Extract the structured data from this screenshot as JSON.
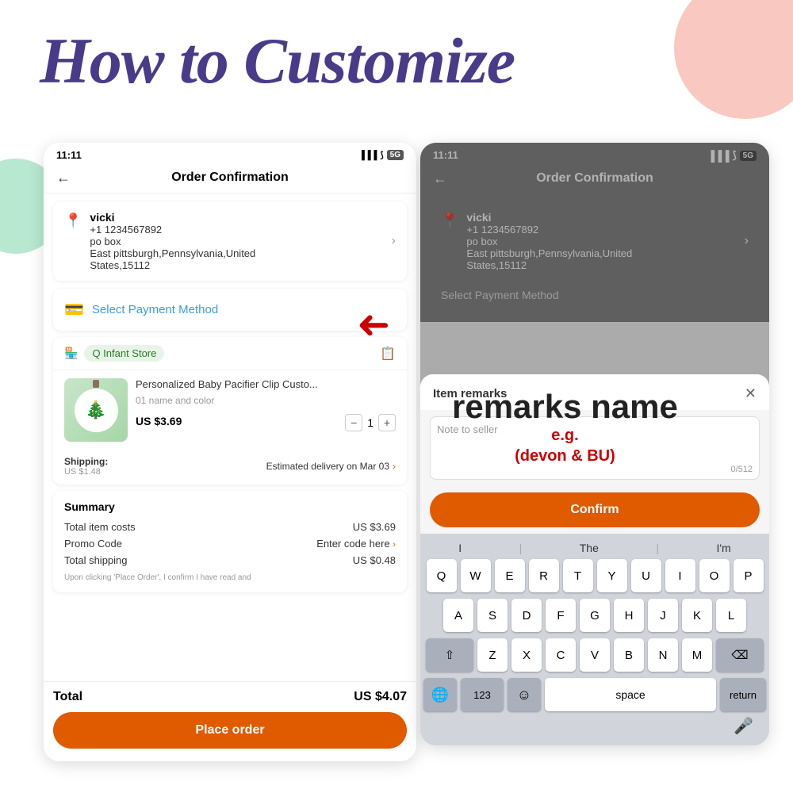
{
  "page": {
    "title": "How to Customize",
    "bg_circle_colors": [
      "#f9c8c0",
      "#b8e8d0"
    ]
  },
  "left_phone": {
    "status_time": "11:11",
    "status_signal": "▐▐▐",
    "status_wifi": "WiFi",
    "status_5g": "5G",
    "header_title": "Order Confirmation",
    "back_arrow": "←",
    "address": {
      "name": "vicki",
      "phone": "+1 1234567892",
      "po": "po box",
      "city": "East pittsburgh,Pennsylvania,United",
      "city2": "States,15112"
    },
    "payment": {
      "label": "Select Payment Method"
    },
    "store": {
      "icon": "🏪",
      "name": "Q Infant Store"
    },
    "product": {
      "title": "Personalized Baby Pacifier Clip Custo...",
      "variant": "01 name and color",
      "price": "US $3.69",
      "qty": "1"
    },
    "shipping": {
      "label": "Shipping:",
      "cost": "US $1.48",
      "estimate": "Estimated delivery on Mar 03"
    },
    "summary": {
      "title": "Summary",
      "item_costs_label": "Total item costs",
      "item_costs_value": "US $3.69",
      "promo_label": "Promo Code",
      "promo_value": "Enter code here",
      "shipping_label": "Total shipping",
      "shipping_value": "US $0.48",
      "disclaimer": "Upon clicking 'Place Order', I confirm I have read and",
      "total_label": "Total",
      "total_value": "US $4.07"
    },
    "place_order_btn": "Place order"
  },
  "right_phone": {
    "status_time": "11:11",
    "header_title": "Order Confirmation",
    "back_arrow": "←",
    "address": {
      "name": "vicki",
      "phone": "+1 1234567892",
      "po": "po box",
      "city": "East pittsburgh,Pennsylvania,United",
      "city2": "States,15112"
    },
    "payment_label": "Select Payment Method"
  },
  "modal": {
    "title": "Item remarks",
    "close": "✕",
    "placeholder": "Note to seller",
    "char_count": "0/512",
    "confirm_btn": "Confirm"
  },
  "keyboard": {
    "suggestions": [
      "I",
      "|",
      "The",
      "|",
      "I'm"
    ],
    "row1": [
      "Q",
      "W",
      "E",
      "R",
      "T",
      "Y",
      "U",
      "I",
      "O",
      "P"
    ],
    "row2": [
      "A",
      "S",
      "D",
      "F",
      "G",
      "H",
      "J",
      "K",
      "L"
    ],
    "row3": [
      "⇧",
      "Z",
      "X",
      "C",
      "V",
      "B",
      "N",
      "M",
      "⌫"
    ],
    "row4_left": "123",
    "row4_emoji": "☺",
    "row4_space": "space",
    "row4_return": "return",
    "row4_globe": "🌐",
    "row4_mic": "🎤"
  },
  "remarks_overlay": {
    "title": "remarks name",
    "eg_label": "e.g.",
    "eg_value": "(devon & BU)"
  },
  "red_arrow": "➜"
}
